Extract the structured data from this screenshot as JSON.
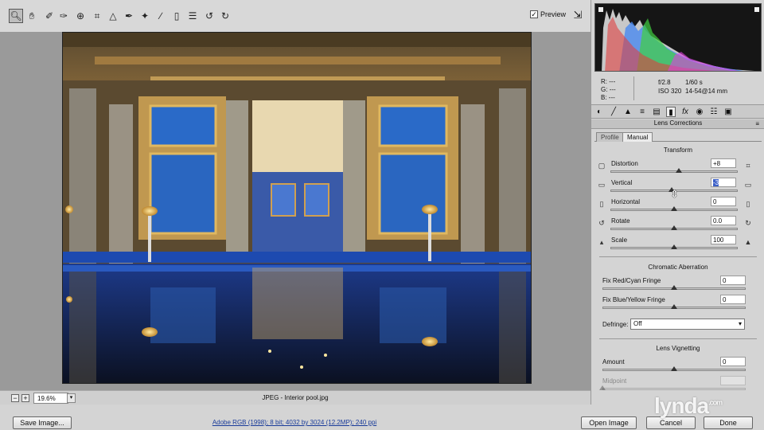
{
  "toolbar": {
    "tools": [
      "zoom-icon",
      "hand-icon",
      "white-balance-icon",
      "color-sampler-icon",
      "target-adjust-icon",
      "crop-icon",
      "straighten-icon",
      "spot-removal-icon",
      "red-eye-icon",
      "adjustment-brush-icon",
      "graduated-filter-icon",
      "preferences-icon",
      "rotate-ccw-icon",
      "rotate-cw-icon"
    ],
    "preview_label": "Preview",
    "preview_checked": true
  },
  "rgb": {
    "r_label": "R:",
    "g_label": "G:",
    "b_label": "B:",
    "r": "---",
    "g": "---",
    "b": "---"
  },
  "exif": {
    "aperture": "f/2.8",
    "shutter": "1/60 s",
    "iso": "ISO 320",
    "lens": "14-54@14 mm"
  },
  "panel": {
    "title": "Lens Corrections",
    "tabs": [
      {
        "label": "Profile",
        "active": false
      },
      {
        "label": "Manual",
        "active": true
      }
    ]
  },
  "transform": {
    "title": "Transform",
    "distortion": {
      "label": "Distortion",
      "value": "+8",
      "fraction": 0.54
    },
    "vertical": {
      "label": "Vertical",
      "value": "-3",
      "fraction": 0.48
    },
    "horizontal": {
      "label": "Horizontal",
      "value": "0",
      "fraction": 0.5
    },
    "rotate": {
      "label": "Rotate",
      "value": "0.0",
      "fraction": 0.5
    },
    "scale": {
      "label": "Scale",
      "value": "100",
      "fraction": 0.5
    }
  },
  "chromatic": {
    "title": "Chromatic Aberration",
    "red_cyan": {
      "label": "Fix Red/Cyan Fringe",
      "value": "0",
      "fraction": 0.5
    },
    "blue_yellow": {
      "label": "Fix Blue/Yellow Fringe",
      "value": "0",
      "fraction": 0.5
    },
    "defringe_label": "Defringe:",
    "defringe_value": "Off"
  },
  "vignetting": {
    "title": "Lens Vignetting",
    "amount": {
      "label": "Amount",
      "value": "0",
      "fraction": 0.5
    },
    "midpoint": {
      "label": "Midpoint",
      "value": "",
      "fraction": 0.0
    }
  },
  "zoom": {
    "value": "19.6%"
  },
  "file": {
    "name": "JPEG - Interior pool.jpg"
  },
  "bottom": {
    "save_label": "Save Image...",
    "workflow": "Adobe RGB (1998); 8 bit; 4032 by 3024 (12.2MP); 240 ppi",
    "open_label": "Open Image",
    "cancel_label": "Cancel",
    "done_label": "Done"
  },
  "watermark": {
    "text": "lynda",
    "suffix": ".com"
  }
}
